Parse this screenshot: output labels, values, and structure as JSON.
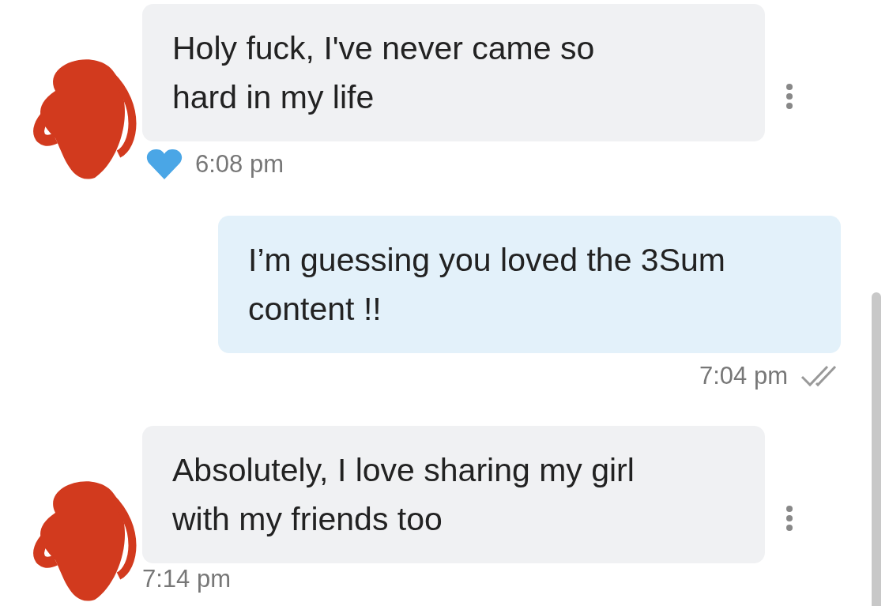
{
  "messages": [
    {
      "kind": "incoming",
      "lines": [
        "Holy fuck, I've never came so",
        "hard in my life"
      ],
      "time": "6:08 pm",
      "liked": true
    },
    {
      "kind": "outgoing",
      "lines": [
        "I’m guessing you loved the 3Sum",
        "content !!"
      ],
      "time": "7:04 pm",
      "liked": false
    },
    {
      "kind": "incoming",
      "lines": [
        "Absolutely, I love sharing my girl",
        "with my friends too"
      ],
      "time": "7:14 pm",
      "liked": false
    }
  ]
}
